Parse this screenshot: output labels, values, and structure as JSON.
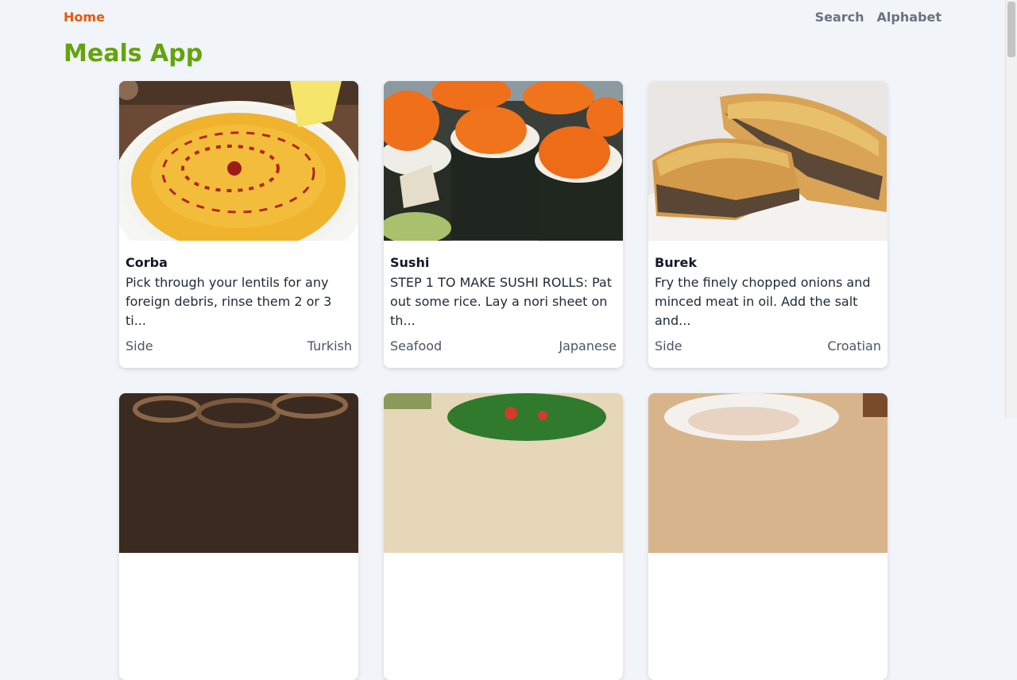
{
  "nav": {
    "home": "Home",
    "search": "Search",
    "alphabet": "Alphabet"
  },
  "title": "Meals App",
  "meals": [
    {
      "name": "Corba",
      "description": "Pick through your lentils for any foreign debris, rinse them 2 or 3 ti...",
      "category": "Side",
      "area": "Turkish"
    },
    {
      "name": "Sushi",
      "description": "STEP 1 TO MAKE SUSHI ROLLS: Pat out some rice. Lay a nori sheet on th...",
      "category": "Seafood",
      "area": "Japanese"
    },
    {
      "name": "Burek",
      "description": "Fry the finely chopped onions and minced meat in oil. Add the salt and...",
      "category": "Side",
      "area": "Croatian"
    },
    {
      "name": "",
      "description": "",
      "category": "",
      "area": ""
    },
    {
      "name": "",
      "description": "",
      "category": "",
      "area": ""
    },
    {
      "name": "",
      "description": "",
      "category": "",
      "area": ""
    }
  ],
  "colors": {
    "accent_nav": "#ea580c",
    "title": "#65a30d",
    "background": "#f1f4f8"
  }
}
